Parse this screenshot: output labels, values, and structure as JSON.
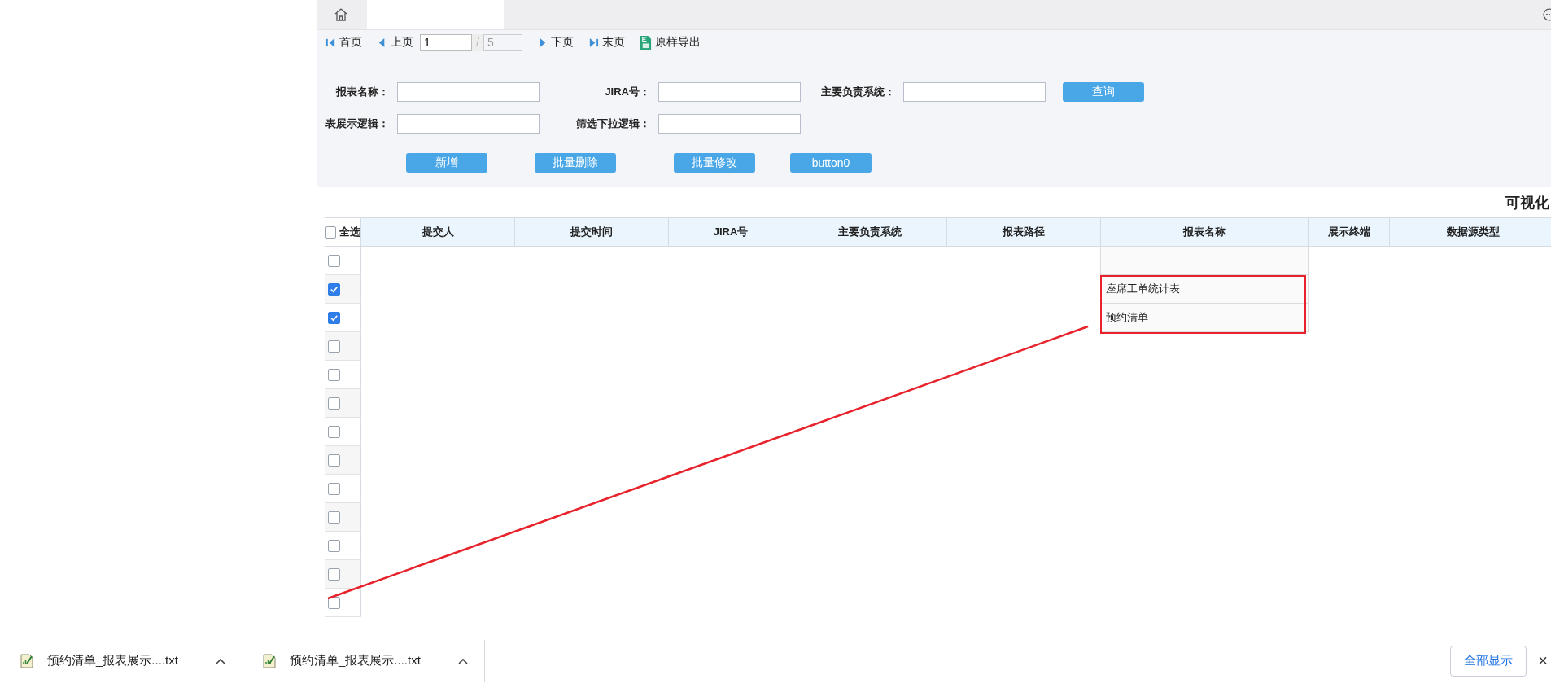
{
  "toolbar": {
    "first": "首页",
    "prev": "上页",
    "page": "1",
    "separator": "/",
    "total": "5",
    "next": "下页",
    "last": "末页",
    "export": "原样导出"
  },
  "form": {
    "fields": [
      {
        "label": "报表名称："
      },
      {
        "label": "JIRA号："
      },
      {
        "label": "主要负责系统："
      },
      {
        "label": "表展示逻辑："
      },
      {
        "label": "筛选下拉逻辑："
      }
    ],
    "search_button": "查询",
    "actions": [
      "新增",
      "批量删除",
      "批量修改",
      "button0"
    ]
  },
  "title": "可视化",
  "table": {
    "select_all": {
      "label": "全选",
      "checked": false
    },
    "columns": [
      "提交人",
      "提交时间",
      "JIRA号",
      "主要负责系统",
      "报表路径",
      "报表名称",
      "展示终端",
      "数据源类型"
    ],
    "rows": [
      {
        "checked": false
      },
      {
        "checked": true,
        "name": "座席工单统计表"
      },
      {
        "checked": true,
        "name": "预约清单"
      },
      {
        "checked": false
      },
      {
        "checked": false
      },
      {
        "checked": false
      },
      {
        "checked": false
      },
      {
        "checked": false
      },
      {
        "checked": false
      },
      {
        "checked": false
      },
      {
        "checked": false
      },
      {
        "checked": false
      },
      {
        "checked": false
      }
    ]
  },
  "downloads": {
    "items": [
      "预约清单_报表展示....txt",
      "预约清单_报表展示....txt"
    ],
    "show_all": "全部显示",
    "close": "×"
  }
}
